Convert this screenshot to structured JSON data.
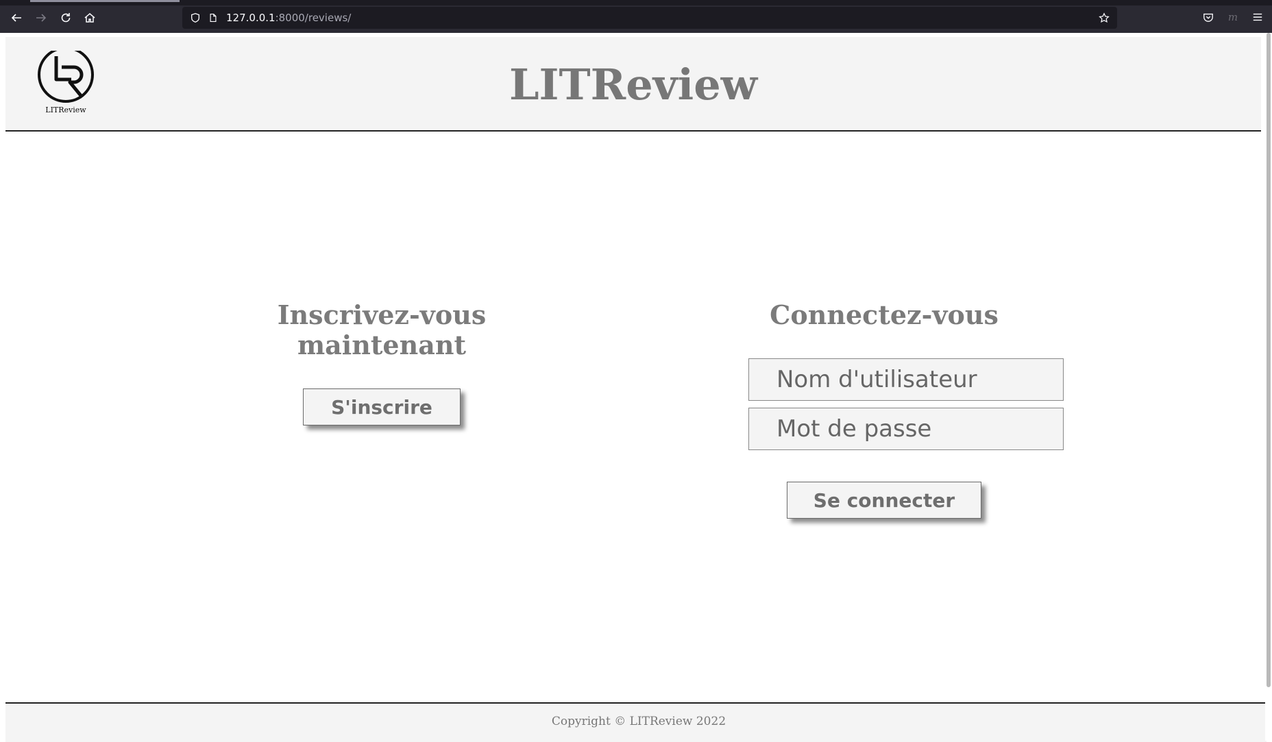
{
  "browser": {
    "url_host": "127.0.0.1",
    "url_rest": ":8000/reviews/"
  },
  "header": {
    "logo_text": "LITReview",
    "title": "LITReview"
  },
  "signup": {
    "title_line1": "Inscrivez-vous",
    "title_line2": "maintenant",
    "button_label": "S'inscrire"
  },
  "login": {
    "title": "Connectez-vous",
    "username_placeholder": "Nom d'utilisateur",
    "password_placeholder": "Mot de passe",
    "button_label": "Se connecter"
  },
  "footer": {
    "copyright": "Copyright © LITReview 2022"
  },
  "colors": {
    "chrome_bg": "#2b2a33",
    "header_bg": "#f4f4f4",
    "title_gray": "#777777"
  },
  "icons": [
    "back-icon",
    "forward-icon",
    "reload-icon",
    "home-icon",
    "shield-icon",
    "page-icon",
    "bookmark-star-icon",
    "pocket-icon",
    "extension-icon",
    "menu-icon"
  ]
}
